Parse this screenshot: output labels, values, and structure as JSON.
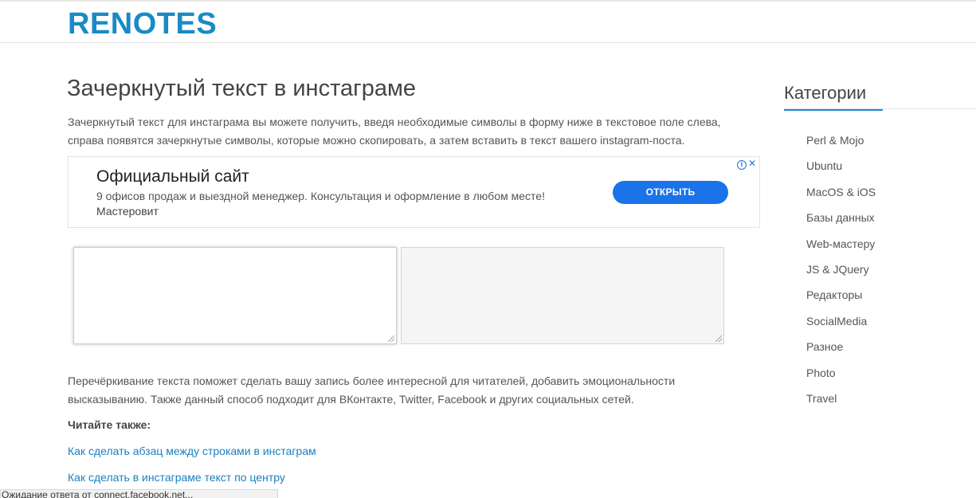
{
  "site": {
    "logo": "RENOTES"
  },
  "article": {
    "title": "Зачеркнутый текст в инстаграме",
    "intro": "Зачеркнутый текст для инстаграма вы можете получить, введя необходимые символы в форму ниже в текстовое поле слева, справа появятся зачеркнутые символы, которые можно скопировать, а затем вставить в текст вашего instagram-поста.",
    "body": "Перечёркивание текста поможет сделать вашу запись более интересной для читателей, добавить эмоциональности высказыванию. Также данный способ подходит для ВКонтакте, Twitter, Facebook и других социальных сетей.",
    "read_also_label": "Читайте также:",
    "links": [
      "Как сделать абзац между строками в инстаграм",
      "Как сделать в инстаграме текст по центру"
    ]
  },
  "ad": {
    "title": "Официальный сайт",
    "description": "9 офисов продаж и выездной менеджер. Консультация и оформление в любом месте!",
    "advertiser": "Мастеровит",
    "button_label": "ОТКРЫТЬ",
    "info_icon": "info-icon",
    "close_icon": "close-icon"
  },
  "converter": {
    "input_value": "",
    "output_value": ""
  },
  "sidebar": {
    "title": "Категории",
    "categories": [
      "Perl & Mojo",
      "Ubuntu",
      "MacOS & iOS",
      "Базы данных",
      "Web-мастеру",
      "JS & JQuery",
      "Редакторы",
      "SocialMedia",
      "Разное",
      "Photo",
      "Travel"
    ]
  },
  "status_bar": {
    "text": "Ожидание ответа от connect.facebook.net..."
  },
  "colors": {
    "brand": "#1a8ac6",
    "link": "#1a7fc0",
    "ad_button": "#1a73e8"
  }
}
